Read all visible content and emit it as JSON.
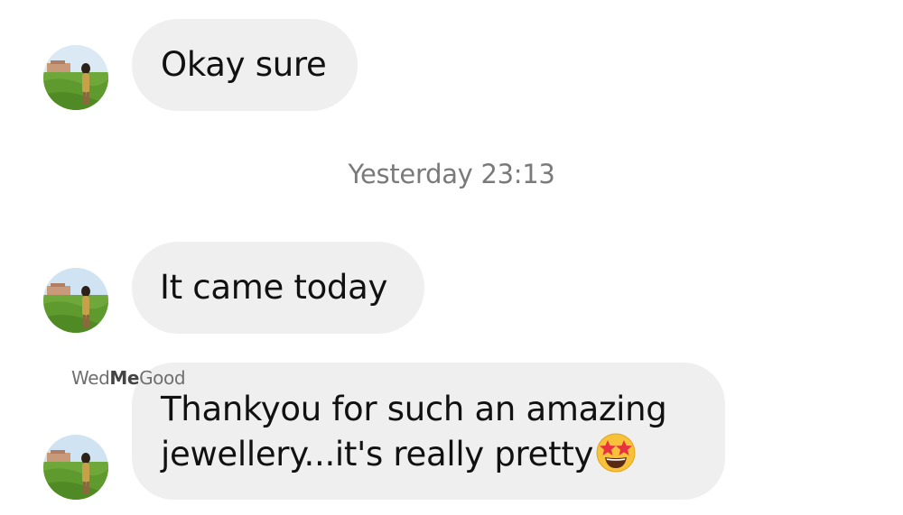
{
  "messages": [
    {
      "text": "Okay sure"
    },
    {
      "text": "It came today"
    },
    {
      "line1": "Thankyou for such an amazing",
      "line2": "jewellery...it's really pretty",
      "emoji": "star-struck-emoji"
    }
  ],
  "timestamp": "Yesterday 23:13",
  "watermark": {
    "part1": "Wed",
    "part2": "Me",
    "part3": "Good"
  },
  "colors": {
    "bubble": "#efefef",
    "timestamp": "#7a7a7a",
    "background": "#ffffff"
  },
  "icons": {
    "avatar": "contact-photo-avatar",
    "emoji": "star-struck-emoji"
  }
}
